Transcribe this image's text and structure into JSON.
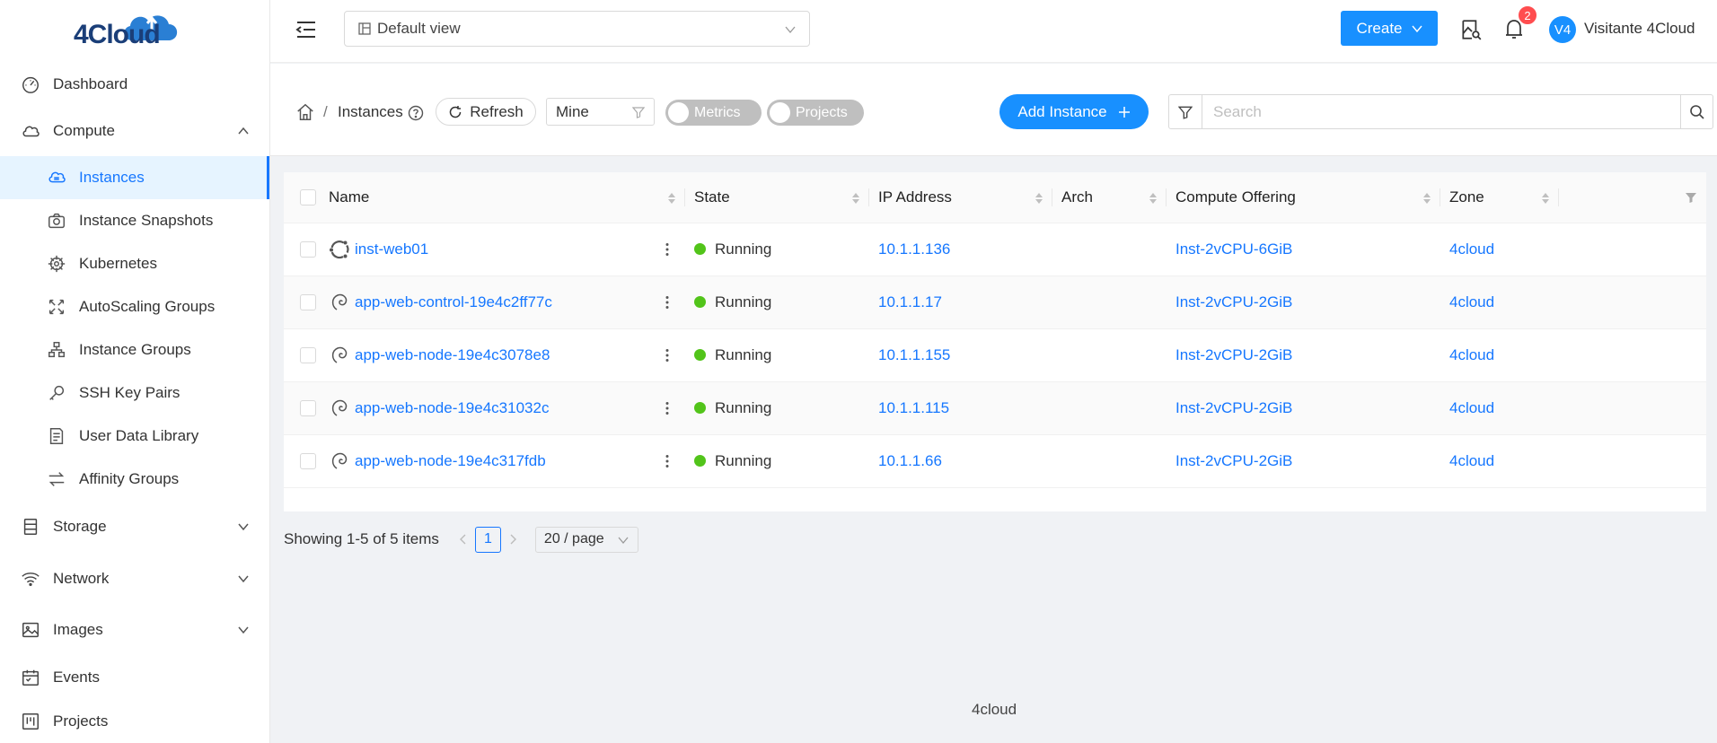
{
  "app": {
    "logo": "4Cloud",
    "footer": "4cloud"
  },
  "sidebar": {
    "items": [
      {
        "label": "Dashboard",
        "icon": "dashboard-icon"
      },
      {
        "label": "Compute",
        "icon": "cloud-icon",
        "expanded": true,
        "children": [
          {
            "label": "Instances",
            "icon": "cloud-server-icon",
            "active": true
          },
          {
            "label": "Instance Snapshots",
            "icon": "camera-icon"
          },
          {
            "label": "Kubernetes",
            "icon": "helm-icon"
          },
          {
            "label": "AutoScaling Groups",
            "icon": "expand-icon"
          },
          {
            "label": "Instance Groups",
            "icon": "cluster-icon"
          },
          {
            "label": "SSH Key Pairs",
            "icon": "key-icon"
          },
          {
            "label": "User Data Library",
            "icon": "document-icon"
          },
          {
            "label": "Affinity Groups",
            "icon": "swap-icon"
          }
        ]
      },
      {
        "label": "Storage",
        "icon": "database-icon"
      },
      {
        "label": "Network",
        "icon": "wifi-icon"
      },
      {
        "label": "Images",
        "icon": "picture-icon"
      },
      {
        "label": "Events",
        "icon": "calendar-icon"
      },
      {
        "label": "Projects",
        "icon": "project-icon"
      }
    ]
  },
  "header": {
    "view_select": "Default view",
    "create_label": "Create",
    "notification_count": "2",
    "avatar_initials": "V4",
    "user_name": "Visitante 4Cloud"
  },
  "toolbar": {
    "breadcrumb_sep": "/",
    "breadcrumb": "Instances",
    "refresh_label": "Refresh",
    "filter_value": "Mine",
    "metrics_label": "Metrics",
    "projects_label": "Projects",
    "add_label": "Add Instance",
    "search_placeholder": "Search"
  },
  "table": {
    "columns": [
      "Name",
      "State",
      "IP Address",
      "Arch",
      "Compute Offering",
      "Zone"
    ],
    "rows": [
      {
        "name": "inst-web01",
        "os": "ubuntu",
        "state": "Running",
        "ip": "10.1.1.136",
        "arch": "",
        "offering": "Inst-2vCPU-6GiB",
        "zone": "4cloud"
      },
      {
        "name": "app-web-control-19e4c2ff77c",
        "os": "debian",
        "state": "Running",
        "ip": "10.1.1.17",
        "arch": "",
        "offering": "Inst-2vCPU-2GiB",
        "zone": "4cloud"
      },
      {
        "name": "app-web-node-19e4c3078e8",
        "os": "debian",
        "state": "Running",
        "ip": "10.1.1.155",
        "arch": "",
        "offering": "Inst-2vCPU-2GiB",
        "zone": "4cloud"
      },
      {
        "name": "app-web-node-19e4c31032c",
        "os": "debian",
        "state": "Running",
        "ip": "10.1.1.115",
        "arch": "",
        "offering": "Inst-2vCPU-2GiB",
        "zone": "4cloud"
      },
      {
        "name": "app-web-node-19e4c317fdb",
        "os": "debian",
        "state": "Running",
        "ip": "10.1.1.66",
        "arch": "",
        "offering": "Inst-2vCPU-2GiB",
        "zone": "4cloud"
      }
    ]
  },
  "pagination": {
    "summary": "Showing 1-5 of 5 items",
    "page": "1",
    "page_size": "20 / page"
  },
  "colors": {
    "accent": "#1890ff",
    "running": "#52c41a",
    "badge": "#ff4d4f"
  }
}
